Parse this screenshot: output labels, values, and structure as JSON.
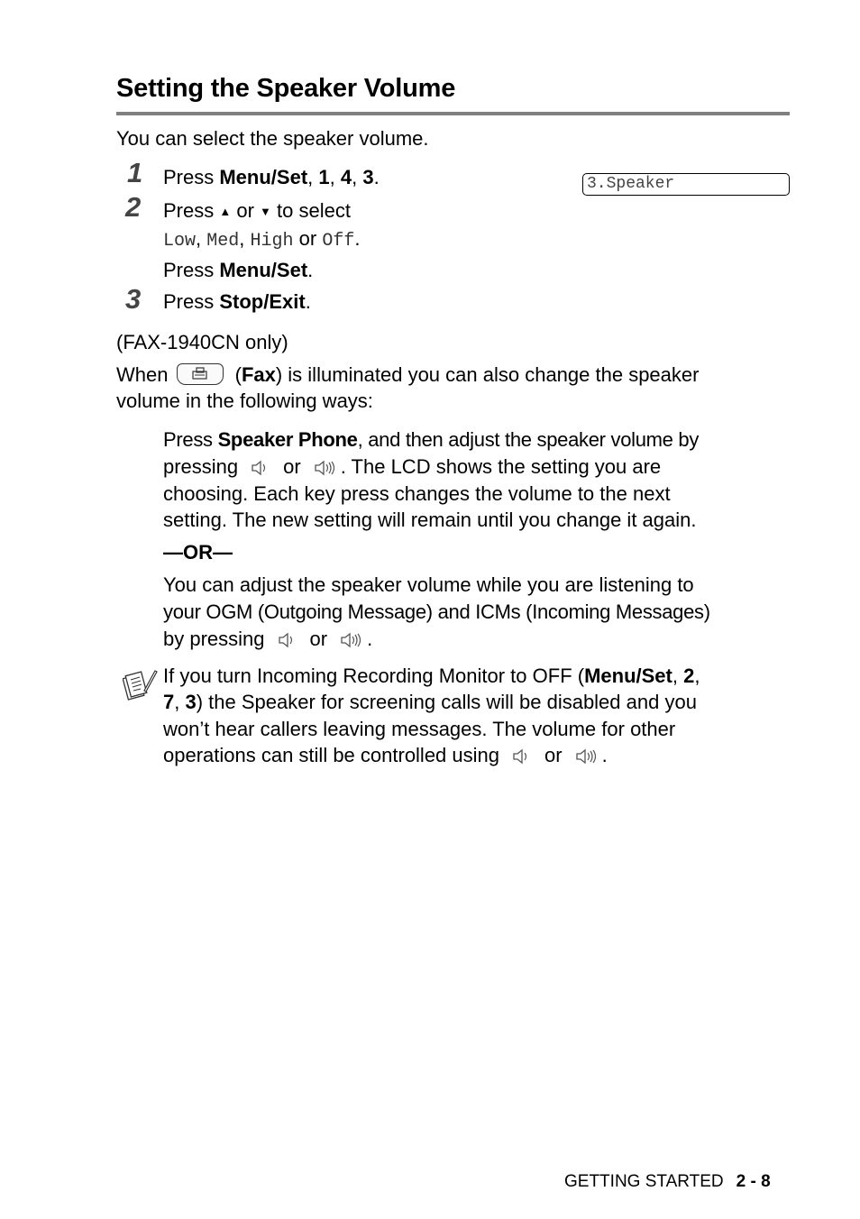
{
  "section": {
    "title": "Setting the Speaker Volume",
    "intro": "You can select the speaker volume."
  },
  "steps": [
    {
      "number": "1",
      "prefix": "Press ",
      "key": "Menu/Set",
      "sep1": ", ",
      "k1": "1",
      "sep2": ", ",
      "k2": "4",
      "sep3": ", ",
      "k3": "3",
      "end": "."
    },
    {
      "number": "2",
      "prefix": "Press ",
      "up": "▲",
      "or": " or ",
      "down": "▼",
      "suffix": " to select",
      "options": [
        "Low",
        "Med",
        "High",
        "Off"
      ],
      "opt_sep": ", ",
      "opt_or": " or ",
      "end": ".",
      "confirm_prefix": "Press ",
      "confirm_key": "Menu/Set",
      "confirm_end": "."
    },
    {
      "number": "3",
      "prefix": "Press ",
      "key": "Stop/Exit",
      "end": "."
    }
  ],
  "lcd": {
    "text": "3.Speaker"
  },
  "fax_section": {
    "model_note": "(FAX-1940CN only)",
    "when": "When",
    "fax_button_icon": "fax-icon",
    "fax_label_open": " (",
    "fax_label": "Fax",
    "fax_label_rest": ") is illuminated you can also change the speaker",
    "line2": "volume in the following ways:"
  },
  "option_a": {
    "l1_prefix": "Press ",
    "l1_key": "Speaker Phone",
    "l1_rest": ", and then adjust the speaker volume by",
    "l2_prefix": "pressing",
    "or": "or",
    "l2_rest": ". The LCD shows the setting you are",
    "l3": "choosing. Each key press changes the volume to the next",
    "l4": "setting. The new setting will remain until you change it again."
  },
  "separator": "—OR—",
  "option_b": {
    "l1": "You can adjust the speaker volume while you are listening to",
    "l2": "your OGM (Outgoing Message) and ICMs (Incoming Messages)",
    "l3_prefix": "by pressing",
    "or": "or",
    "l3_end": "."
  },
  "note": {
    "icon": "note-pencil-icon",
    "l1_prefix": "If you turn Incoming Recording Monitor to OFF (",
    "l1_key": "Menu/Set",
    "l1_sep": ", ",
    "l1_k1": "2",
    "l1_end": ",",
    "l2_k2": "7",
    "l2_sep": ", ",
    "l2_k3": "3",
    "l2_rest": ") the Speaker for screening calls will be disabled and you",
    "l3": "won’t hear callers leaving messages. The volume for other",
    "l4_prefix": "operations can still be controlled using",
    "or": "or",
    "l4_end": "."
  },
  "footer": {
    "section": "GETTING STARTED",
    "page": "2 - 8"
  }
}
